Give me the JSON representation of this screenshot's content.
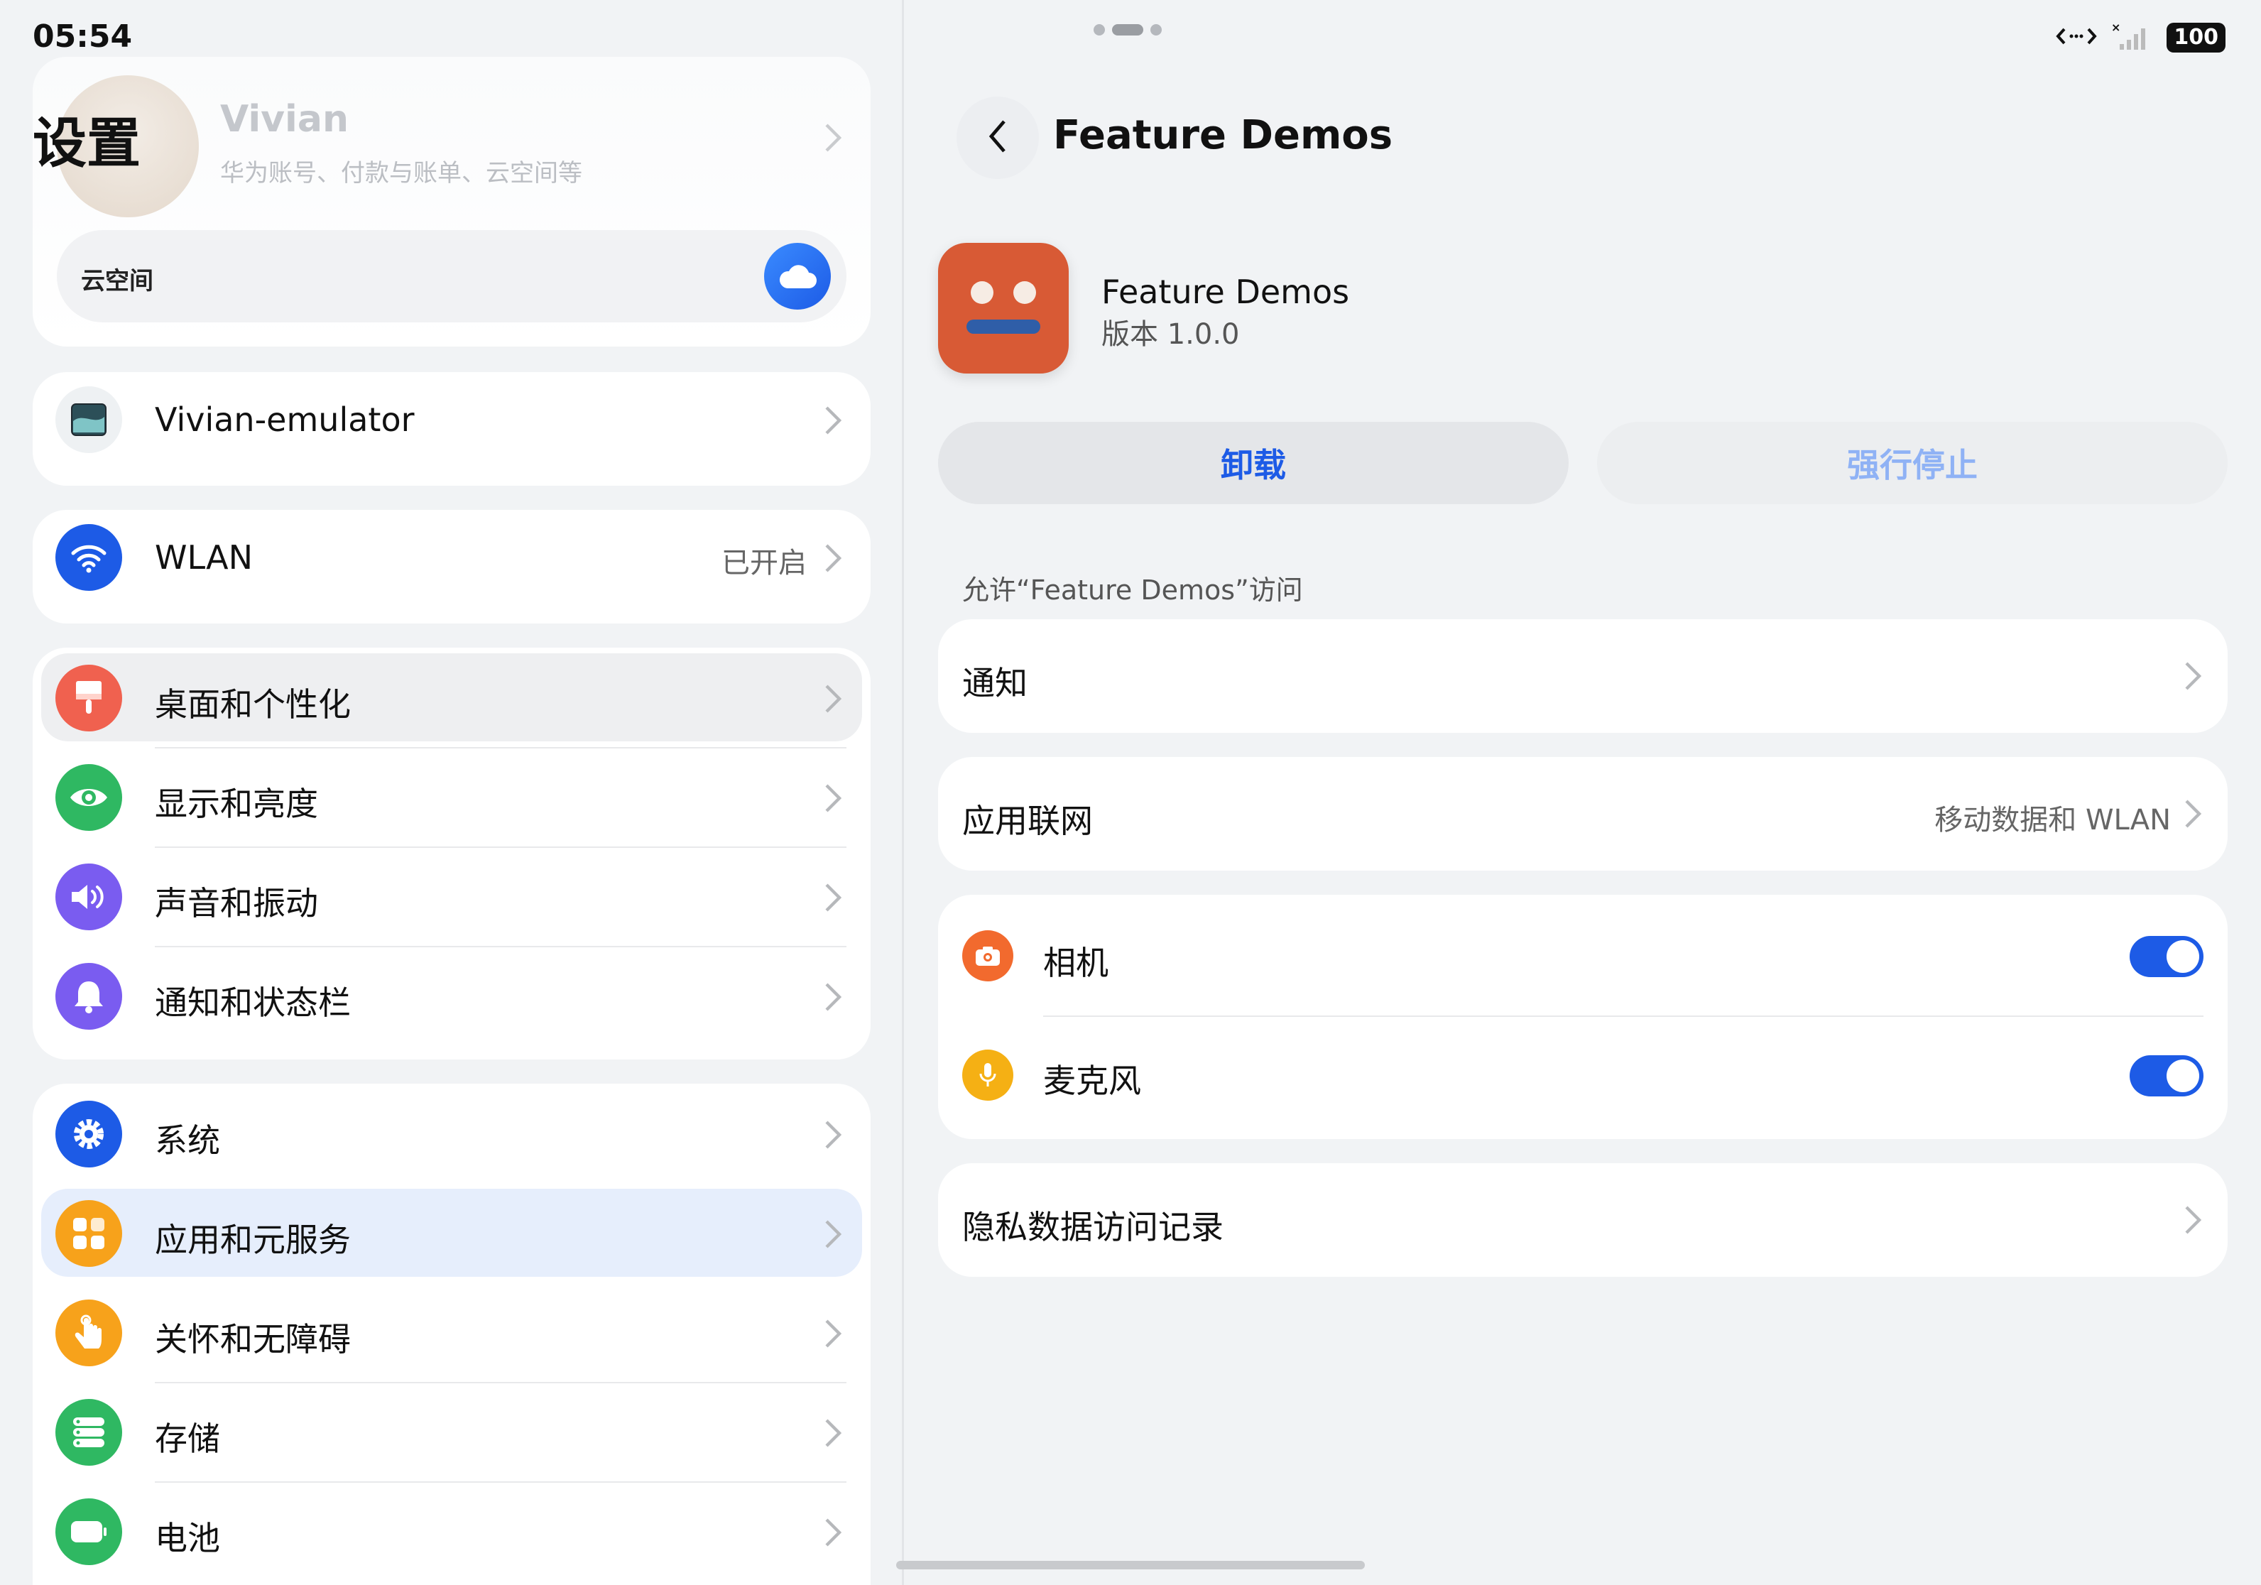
{
  "status_bar": {
    "time": "05:54",
    "battery": "100"
  },
  "settings": {
    "title": "设置",
    "account": {
      "name": "Vivian",
      "subtitle": "华为账号、付款与账单、云空间等",
      "cloud_label": "云空间"
    },
    "device": {
      "label": "Vivian-emulator"
    },
    "wlan": {
      "label": "WLAN",
      "value": "已开启"
    },
    "group1": [
      {
        "label": "桌面和个性化",
        "icon": "paintbrush-icon",
        "color": "#f0614f"
      },
      {
        "label": "显示和亮度",
        "icon": "eye-icon",
        "color": "#2fb862"
      },
      {
        "label": "声音和振动",
        "icon": "speaker-icon",
        "color": "#7a5cf0"
      },
      {
        "label": "通知和状态栏",
        "icon": "bell-icon",
        "color": "#7a5cf0"
      }
    ],
    "group2": [
      {
        "label": "系统",
        "icon": "gear-icon",
        "color": "#1d5be6"
      },
      {
        "label": "应用和元服务",
        "icon": "apps-grid-icon",
        "color": "#f7a21b"
      },
      {
        "label": "关怀和无障碍",
        "icon": "hand-icon",
        "color": "#f7a21b"
      },
      {
        "label": "存储",
        "icon": "storage-icon",
        "color": "#2fb862"
      },
      {
        "label": "电池",
        "icon": "battery-icon",
        "color": "#2fb862"
      }
    ]
  },
  "detail": {
    "title": "Feature Demos",
    "app_name": "Feature Demos",
    "app_version": "版本 1.0.0",
    "uninstall_label": "卸载",
    "force_stop_label": "强行停止",
    "section_caption": "允许“Feature Demos”访问",
    "notification_label": "通知",
    "network_label": "应用联网",
    "network_value": "移动数据和 WLAN",
    "permissions": [
      {
        "label": "相机",
        "icon": "camera-icon",
        "color": "#f26a2e",
        "enabled": true
      },
      {
        "label": "麦克风",
        "icon": "microphone-icon",
        "color": "#f5b014",
        "enabled": true
      }
    ],
    "privacy_label": "隐私数据访问记录"
  },
  "colors": {
    "accent": "#1d5be6",
    "app_icon": "#d85a35"
  }
}
